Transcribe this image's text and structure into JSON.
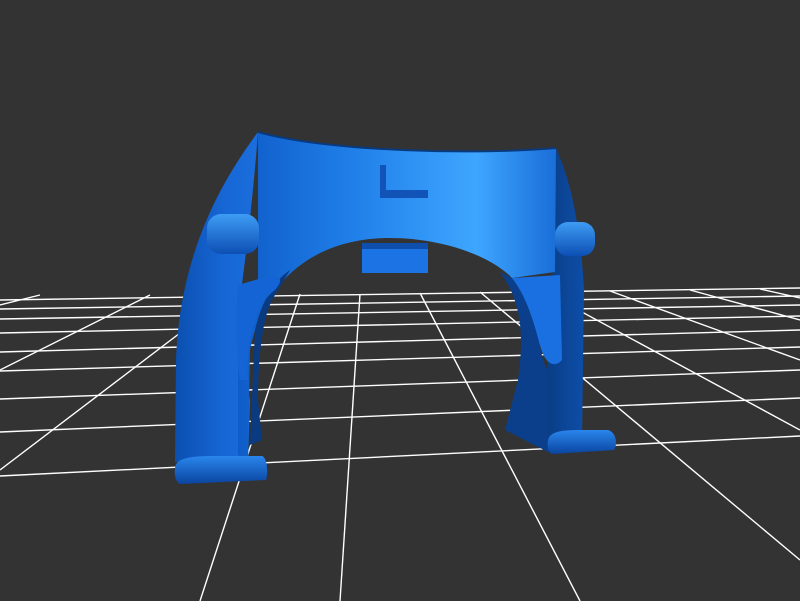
{
  "viewer": {
    "background_color": "#333333",
    "grid_color": "#ffffff",
    "model_color": "#1e6fe0",
    "model_highlight": "#3ea0ff",
    "model_shadow": "#0a3f8a"
  }
}
